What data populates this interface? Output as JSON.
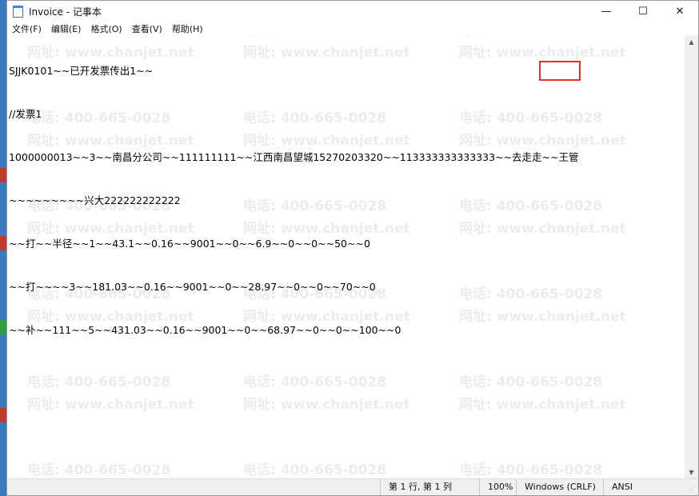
{
  "window": {
    "title": "Invoice - 记事本"
  },
  "controls": {
    "minimize": "—",
    "maximize": "☐",
    "close": "✕"
  },
  "menu": [
    "文件(F)",
    "编辑(E)",
    "格式(O)",
    "查看(V)",
    "帮助(H)"
  ],
  "content_lines": [
    "SJJK0101~~已开发票传出1~~",
    "//发票1",
    "1000000013~~3~~南昌分公司~~111111111~~江西南昌望城15270203320~~113333333333333~~去走走~~王管",
    "~~~~~~~~~兴大222222222222",
    "~~打~~半径~~1~~43.1~~0.16~~9001~~0~~6.9~~0~~0~~50~~0",
    "~~打~~~~3~~181.03~~0.16~~9001~~0~~28.97~~0~~0~~70~~0",
    "~~补~~111~~5~~431.03~~0.16~~9001~~0~~68.97~~0~~0~~100~~0"
  ],
  "watermark": {
    "phone": "电话: 400-665-0028",
    "site": "网址: www.chanjet.net"
  },
  "status": {
    "position": "第 1 行, 第 1 列",
    "zoom": "100%",
    "line_ending": "Windows (CRLF)",
    "encoding": "ANSI"
  },
  "colors": {
    "highlight": "#e03030",
    "desktop": "#3a7bbf"
  }
}
